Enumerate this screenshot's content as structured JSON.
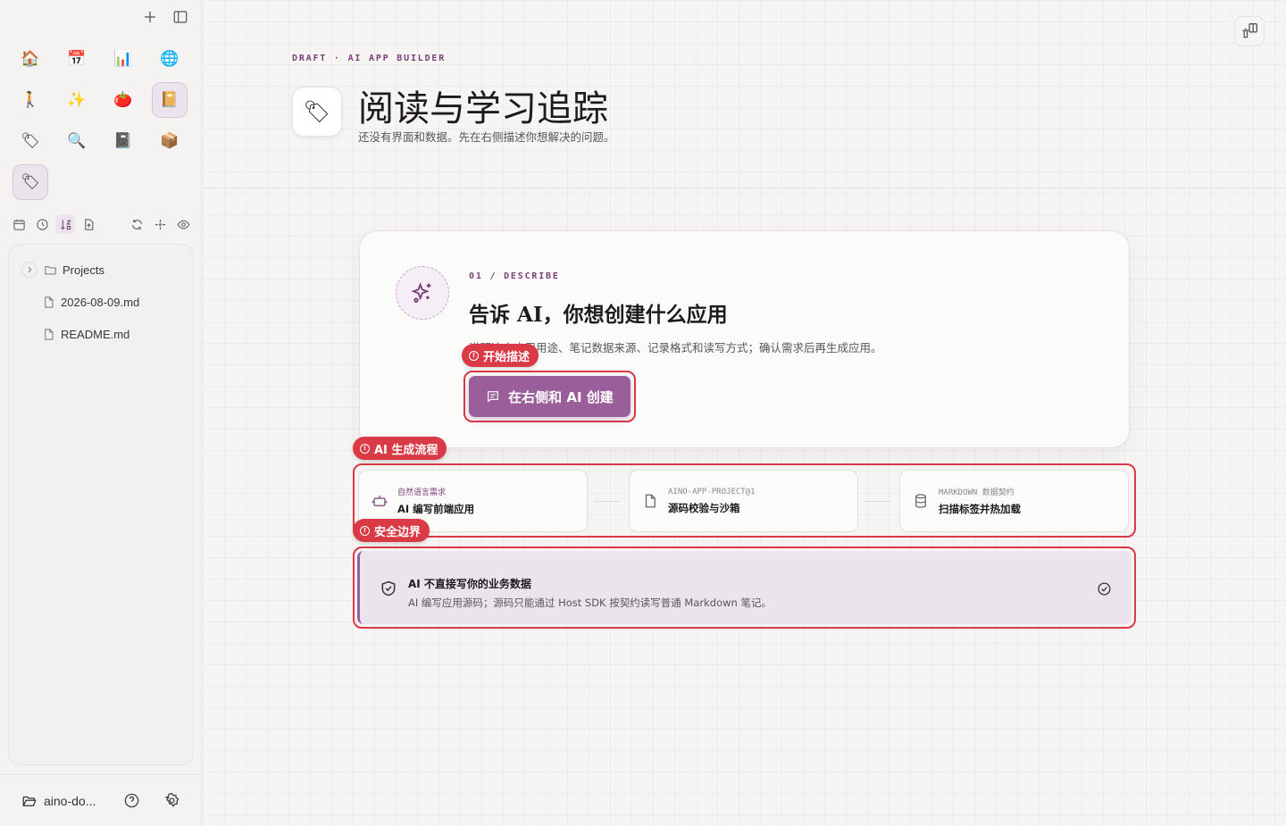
{
  "sidebar": {
    "apps": [
      {
        "name": "home",
        "glyph": "🏠"
      },
      {
        "name": "calendar",
        "glyph": "📅"
      },
      {
        "name": "chart",
        "glyph": "📊"
      },
      {
        "name": "globe",
        "glyph": "🌐"
      },
      {
        "name": "walk",
        "glyph": "🚶"
      },
      {
        "name": "sparkles",
        "glyph": "✨"
      },
      {
        "name": "tomato",
        "glyph": "🍅"
      },
      {
        "name": "notebook",
        "glyph": "📔"
      },
      {
        "name": "tag",
        "glyph": "🏷"
      },
      {
        "name": "search",
        "glyph": "🔍"
      },
      {
        "name": "book",
        "glyph": "📓"
      },
      {
        "name": "box",
        "glyph": "📦"
      },
      {
        "name": "reading-tracker",
        "glyph": "🏷"
      }
    ],
    "tree": {
      "folder": "Projects",
      "files": [
        "2026-08-09.md",
        "README.md"
      ]
    },
    "workspace_label": "aino-do..."
  },
  "main": {
    "kicker": "DRAFT · AI APP BUILDER",
    "title_glyph": "🏷",
    "title": "阅读与学习追踪",
    "subtitle": "还没有界面和数据。先在右侧描述你想解决的问题。",
    "card": {
      "step": "01 / DESCRIBE",
      "title": "告诉 AI，你想创建什么应用",
      "desc": "说明这个应用用途、笔记数据来源、记录格式和读写方式；确认需求后再生成应用。",
      "cta": "在右侧和 AI 创建"
    },
    "tags": {
      "start": "开始描述",
      "flow": "AI 生成流程",
      "safety": "安全边界"
    },
    "flow": [
      {
        "small": "自然语言需求",
        "main": "AI 编写前端应用"
      },
      {
        "small": "AINO-APP-PROJECT@1",
        "main": "源码校验与沙箱"
      },
      {
        "small": "MARKDOWN 数据契约",
        "main": "扫描标签并热加载"
      }
    ],
    "safety": {
      "title": "AI 不直接写你的业务数据",
      "desc": "AI 编写应用源码；源码只能通过 Host SDK 按契约读写普通 Markdown 笔记。"
    }
  },
  "colors": {
    "accent": "#9a5f9a",
    "highlight": "#d93a45"
  }
}
